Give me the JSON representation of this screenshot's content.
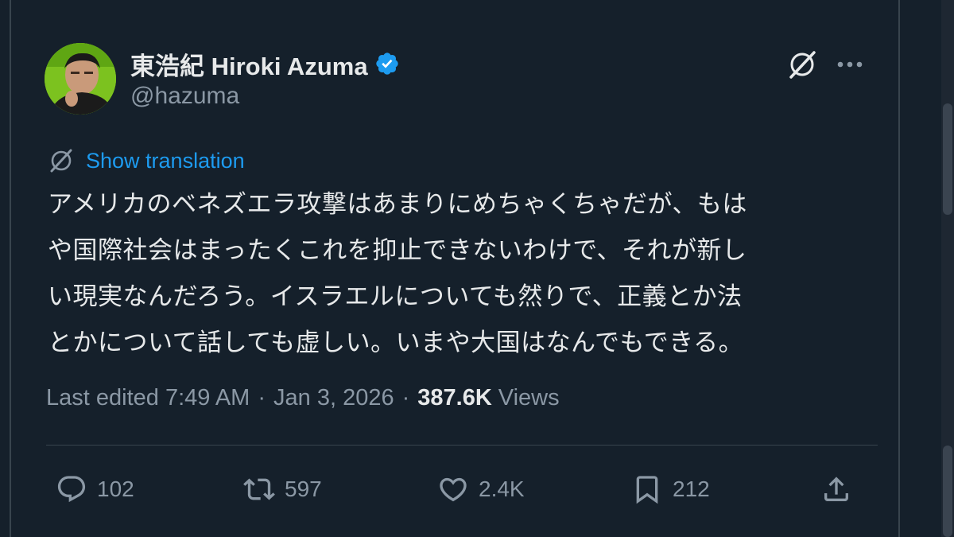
{
  "author": {
    "display_name": "東浩紀 Hiroki Azuma",
    "handle": "@hazuma",
    "verified": true
  },
  "header_actions": {
    "grok_icon": "grok-slash-icon",
    "more_icon": "more-dots-icon"
  },
  "translation": {
    "label": "Show translation",
    "icon": "grok-slash-icon"
  },
  "tweet": {
    "lines": [
      "アメリカのベネズエラ攻撃はあまりにめちゃくちゃだが、もは",
      "や国際社会はまったくこれを抑止できないわけで、それが新し",
      "い現実なんだろう。イスラエルについても然りで、正義とか法",
      "とかについて話しても虚しい。いまや大国はなんでもできる。"
    ]
  },
  "meta": {
    "edited": "Last edited 7:49 AM",
    "separator": "·",
    "date": "Jan 3, 2026",
    "views_count": "387.6K",
    "views_label": "Views"
  },
  "actions": {
    "reply": {
      "count": "102",
      "icon": "reply-icon"
    },
    "repost": {
      "count": "597",
      "icon": "repost-icon"
    },
    "like": {
      "count": "2.4K",
      "icon": "heart-icon"
    },
    "bookmark": {
      "count": "212",
      "icon": "bookmark-icon"
    },
    "share": {
      "icon": "share-icon"
    }
  },
  "colors": {
    "background": "#15202b",
    "text": "#e7e9ea",
    "muted": "#8b98a5",
    "link": "#1d9bf0",
    "verified": "#1d9bf0",
    "border": "#38444d"
  }
}
